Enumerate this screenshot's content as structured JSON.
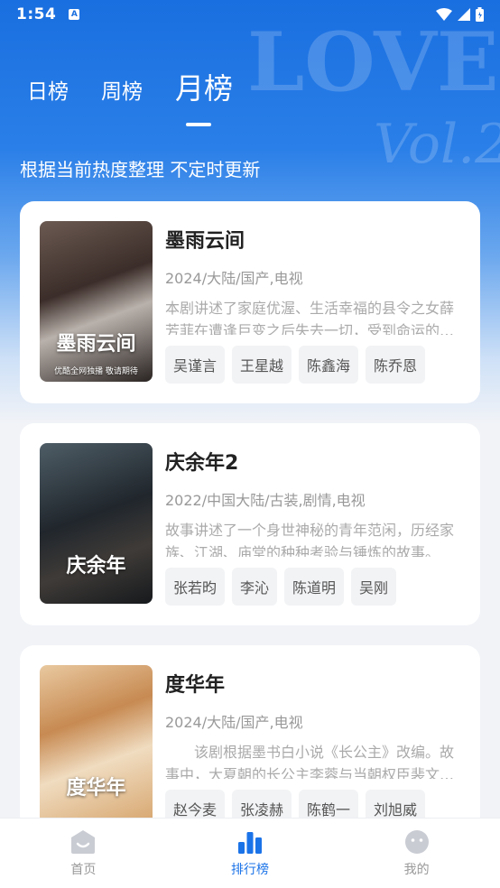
{
  "status_bar": {
    "time": "1:54",
    "notification_icon": "A"
  },
  "tabs": [
    {
      "label": "日榜",
      "active": false
    },
    {
      "label": "周榜",
      "active": false
    },
    {
      "label": "月榜",
      "active": true
    }
  ],
  "subtitle": "根据当前热度整理 不定时更新",
  "items": [
    {
      "title": "墨雨云间",
      "meta": "2024/大陆/国产,电视",
      "desc": "本剧讲述了家庭优渥、生活幸福的县令之女薛芳菲在遭逢巨变之后失去一切，受到命运的捉弄之后奋起反击的故事。",
      "poster_title": "墨雨云间",
      "poster_caption": "优酷全网独播 敬请期待",
      "tags": [
        "吴谨言",
        "王星越",
        "陈鑫海",
        "陈乔恩"
      ]
    },
    {
      "title": "庆余年2",
      "meta": "2022/中国大陆/古装,剧情,电视",
      "desc": "故事讲述了一个身世神秘的青年范闲，历经家族、江湖、庙堂的种种考验与锤炼的故事。",
      "poster_title": "庆余年",
      "poster_caption": "",
      "tags": [
        "张若昀",
        "李沁",
        "陈道明",
        "吴刚"
      ]
    },
    {
      "title": "度华年",
      "meta": "2024/大陆/国产,电视",
      "desc": "　　该剧根据墨书白小说《长公主》改编。故事中，大夏朝的长公主李蓉与当朝权臣裴文宣的故事。",
      "poster_title": "度华年",
      "poster_caption": "",
      "tags": [
        "赵今麦",
        "张凌赫",
        "陈鹤一",
        "刘旭威"
      ]
    }
  ],
  "bottom_nav": [
    {
      "label": "首页",
      "icon": "home-icon",
      "active": false
    },
    {
      "label": "排行榜",
      "icon": "ranking-icon",
      "active": true
    },
    {
      "label": "我的",
      "icon": "profile-icon",
      "active": false
    }
  ],
  "colors": {
    "accent": "#1b73e8",
    "hero_top": "#1a6fe0",
    "inactive": "#999999"
  }
}
